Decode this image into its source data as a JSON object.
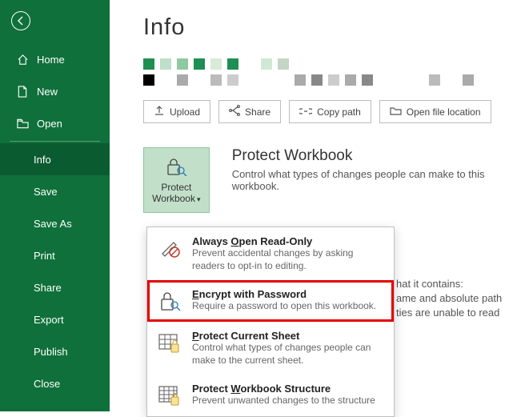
{
  "sidebar": [
    {
      "label": "Home",
      "icon": "home"
    },
    {
      "label": "New",
      "icon": "doc"
    },
    {
      "label": "Open",
      "icon": "folder"
    },
    {
      "label": "Info",
      "active": true
    },
    {
      "label": "Save"
    },
    {
      "label": "Save As"
    },
    {
      "label": "Print"
    },
    {
      "label": "Share"
    },
    {
      "label": "Export"
    },
    {
      "label": "Publish"
    },
    {
      "label": "Close"
    }
  ],
  "page_title": "Info",
  "thumb_colors_row1": [
    "#1e8e52",
    "#bedfc9",
    "#8fc99f",
    "#1e8e52",
    "#d9ead9",
    "#1e8e52",
    "#fff",
    "#d0e8d5",
    "#c3d6c6"
  ],
  "thumb_colors_row2": [
    "#000",
    "#fff",
    "#aaa",
    "#fff",
    "#bbb",
    "#ccc",
    "#fff",
    "#fff",
    "#fff",
    "#aaa",
    "#888",
    "#ccc",
    "#aaa",
    "#888",
    "#fff",
    "#fff",
    "#fff",
    "#bbb",
    "#fff",
    "#aaa"
  ],
  "actions": [
    {
      "label": "Upload",
      "icon": "upload"
    },
    {
      "label": "Share",
      "icon": "share"
    },
    {
      "label": "Copy path",
      "icon": "link"
    },
    {
      "label": "Open file location",
      "icon": "folder"
    }
  ],
  "protect_btn": {
    "line1": "Protect",
    "line2": "Workbook"
  },
  "protect_heading": "Protect Workbook",
  "protect_desc": "Control what types of changes people can make to this workbook.",
  "dropdown": [
    {
      "title": "Always Open Read-Only",
      "hot": "O",
      "desc": "Prevent accidental changes by asking readers to opt-in to editing.",
      "icon": "readonly"
    },
    {
      "title": "Encrypt with Password",
      "hot": "E",
      "desc": "Require a password to open this workbook.",
      "icon": "encrypt",
      "highlight": true
    },
    {
      "title": "Protect Current Sheet",
      "hot": "P",
      "desc": "Control what types of changes people can make to the current sheet.",
      "icon": "sheet"
    },
    {
      "title": "Protect Workbook Structure",
      "hot": "W",
      "desc": "Prevent unwanted changes to the structure",
      "icon": "structure"
    }
  ],
  "ghost_lines": [
    "hat it contains:",
    "ame and absolute path",
    "ties are unable to read"
  ]
}
